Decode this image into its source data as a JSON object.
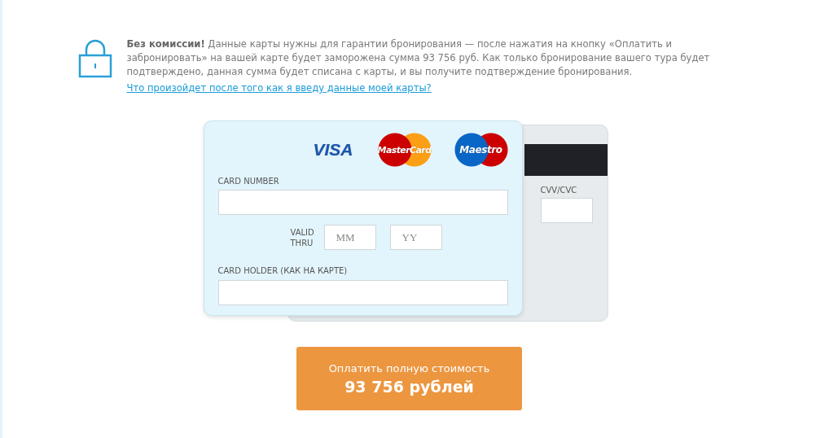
{
  "notice": {
    "text": "**Без комиссии!** Данные карты нужны для гарантии бронирования — после нажатия на кнопку «Оплатить и забронировать» на вашей карте будет заморожена сумма 93 756 руб. Как только бронирование вашего тура будет подтверждено, данная сумма будет списана с карты, и вы получите подтверждение бронирования.",
    "link": "Что произойдет после того как я введу данные моей карты?"
  },
  "card_front": {
    "logos": [
      {
        "kind": "visa",
        "text": "VISA"
      },
      {
        "kind": "mastercard",
        "text": "MasterCard"
      },
      {
        "kind": "maestro",
        "text": "Maestro"
      }
    ],
    "card_number_label": "CARD NUMBER",
    "valid_thru_label": "VALID THRU",
    "month_placeholder": "MM",
    "year_placeholder": "YY",
    "holder_label": "CARD HOLDER (КАК НА КАРТЕ)"
  },
  "card_back": {
    "cvv_label": "CVV/CVC"
  },
  "pay_button": {
    "label": "Оплатить полную стоимость",
    "amount": "93 756 рублей"
  }
}
